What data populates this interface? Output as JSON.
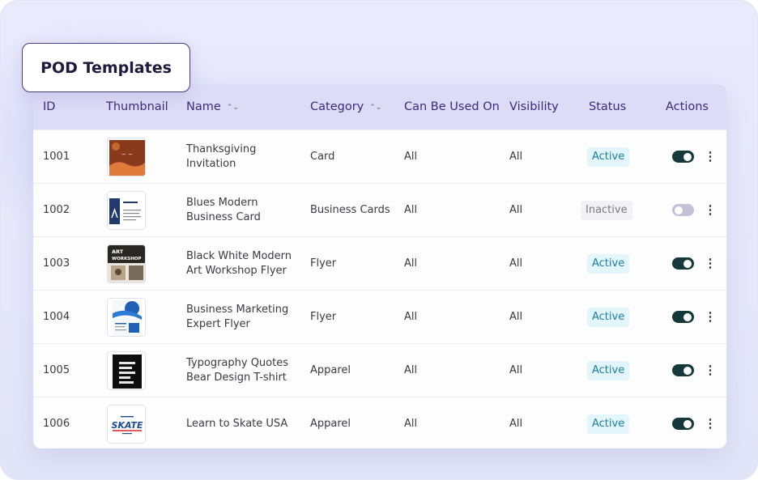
{
  "title": "POD Templates",
  "table": {
    "columns": {
      "id": "ID",
      "thumbnail": "Thumbnail",
      "name": "Name",
      "category": "Category",
      "can_be_used_on": "Can Be Used On",
      "visibility": "Visibility",
      "status": "Status",
      "actions": "Actions"
    },
    "sort_glyph": "⌃⌄",
    "rows": [
      {
        "id": "1001",
        "name_line1": "Thanksgiving",
        "name_line2": "Invitation",
        "category": "Card",
        "used_on": "All",
        "visibility": "All",
        "status": "Active",
        "enabled": true,
        "thumbnail_icon": "thanksgiving-card-thumbnail"
      },
      {
        "id": "1002",
        "name_line1": "Blues Modern",
        "name_line2": "Business Card",
        "category": "Business Cards",
        "used_on": "All",
        "visibility": "All",
        "status": "Inactive",
        "enabled": false,
        "thumbnail_icon": "business-card-thumbnail"
      },
      {
        "id": "1003",
        "name_line1": "Black White Modern",
        "name_line2": "Art Workshop Flyer",
        "category": "Flyer",
        "used_on": "All",
        "visibility": "All",
        "status": "Active",
        "enabled": true,
        "thumbnail_icon": "art-workshop-flyer-thumbnail"
      },
      {
        "id": "1004",
        "name_line1": "Business Marketing",
        "name_line2": "Expert Flyer",
        "category": "Flyer",
        "used_on": "All",
        "visibility": "All",
        "status": "Active",
        "enabled": true,
        "thumbnail_icon": "marketing-flyer-thumbnail"
      },
      {
        "id": "1005",
        "name_line1": "Typography Quotes",
        "name_line2": "Bear Design T-shirt",
        "category": "Apparel",
        "used_on": "All",
        "visibility": "All",
        "status": "Active",
        "enabled": true,
        "thumbnail_icon": "tshirt-thumbnail"
      },
      {
        "id": "1006",
        "name_line1": "Learn to Skate USA",
        "name_line2": "",
        "category": "Apparel",
        "used_on": "All",
        "visibility": "All",
        "status": "Active",
        "enabled": true,
        "thumbnail_icon": "skate-logo-thumbnail"
      }
    ]
  },
  "thumbnail_text": {
    "art_workshop": "ART WORKSHOP",
    "skate": "SKATE"
  },
  "menu_glyph": "⋮",
  "colors": {
    "header_bg": "#dddcf6",
    "header_text": "#3b2b78",
    "active_badge_bg": "#e3f6fb",
    "active_badge_text": "#1c7ea3",
    "inactive_badge_bg": "#f2f1f5",
    "toggle_on": "#15393a",
    "toggle_off": "#c3c0da",
    "title_border": "#4b3a8c"
  }
}
